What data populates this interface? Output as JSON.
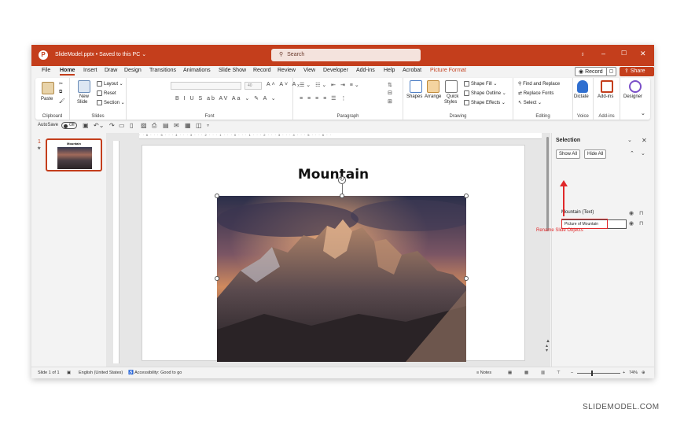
{
  "titlebar": {
    "doc_title": "SlideModel.pptx • Saved to this PC ⌄",
    "search_placeholder": "Search"
  },
  "tabs": [
    "File",
    "Home",
    "Insert",
    "Draw",
    "Design",
    "Transitions",
    "Animations",
    "Slide Show",
    "Record",
    "Review",
    "View",
    "Developer",
    "Add-ins",
    "Help",
    "Acrobat",
    "Picture Format"
  ],
  "active_tab": "Home",
  "contextual_tab": "Picture Format",
  "top_right": {
    "record_label": "Record",
    "share_label": "Share"
  },
  "ribbon": {
    "clipboard": {
      "label": "Clipboard",
      "paste": "Paste"
    },
    "slides": {
      "label": "Slides",
      "new_slide": "New",
      "new_slide_2": "Slide",
      "layout": "Layout",
      "reset": "Reset",
      "section": "Section"
    },
    "font": {
      "label": "Font",
      "size": "40"
    },
    "paragraph": {
      "label": "Paragraph"
    },
    "drawing": {
      "label": "Drawing",
      "shapes": "Shapes",
      "arrange": "Arrange",
      "quick_styles": "Quick",
      "quick_styles_2": "Styles",
      "shape_fill": "Shape Fill",
      "shape_outline": "Shape Outline",
      "shape_effects": "Shape Effects"
    },
    "editing": {
      "label": "Editing",
      "find_replace": "Find and Replace",
      "replace_fonts": "Replace Fonts",
      "select": "Select"
    },
    "voice": {
      "label": "Voice",
      "dictate": "Dictate"
    },
    "addins": {
      "label": "Add-ins",
      "addins_btn": "Add-ins"
    },
    "designer": {
      "designer_btn": "Designer"
    }
  },
  "qat": {
    "autosave_label": "AutoSave",
    "autosave_state": "Off"
  },
  "thumbnails": {
    "slide_number": "1",
    "star": "★",
    "slide_title": "Mountain"
  },
  "slide": {
    "title": "Mountain"
  },
  "ruler_text": "· · 6 · · · 5 · · · 4 · · · 3 · · · 2 · · · 1 · · · 0 · · · 1 · · · 2 · · · 3 · · · 4 · · · 5 · · · 6 · ·",
  "selection_pane": {
    "title": "Selection",
    "show_all": "Show All",
    "hide_all": "Hide All",
    "items": [
      {
        "name": "Mountain (Text)"
      },
      {
        "name": "Picture of Mountain"
      }
    ],
    "callout": "Rename Slide Objects"
  },
  "statusbar": {
    "slide_count": "Slide 1 of 1",
    "language": "English (United States)",
    "accessibility": "Accessibility: Good to go",
    "notes": "Notes",
    "zoom": "74%"
  },
  "watermark": "SLIDEMODEL.COM",
  "colors": {
    "accent": "#c43e1c",
    "callout": "#e0282a"
  }
}
